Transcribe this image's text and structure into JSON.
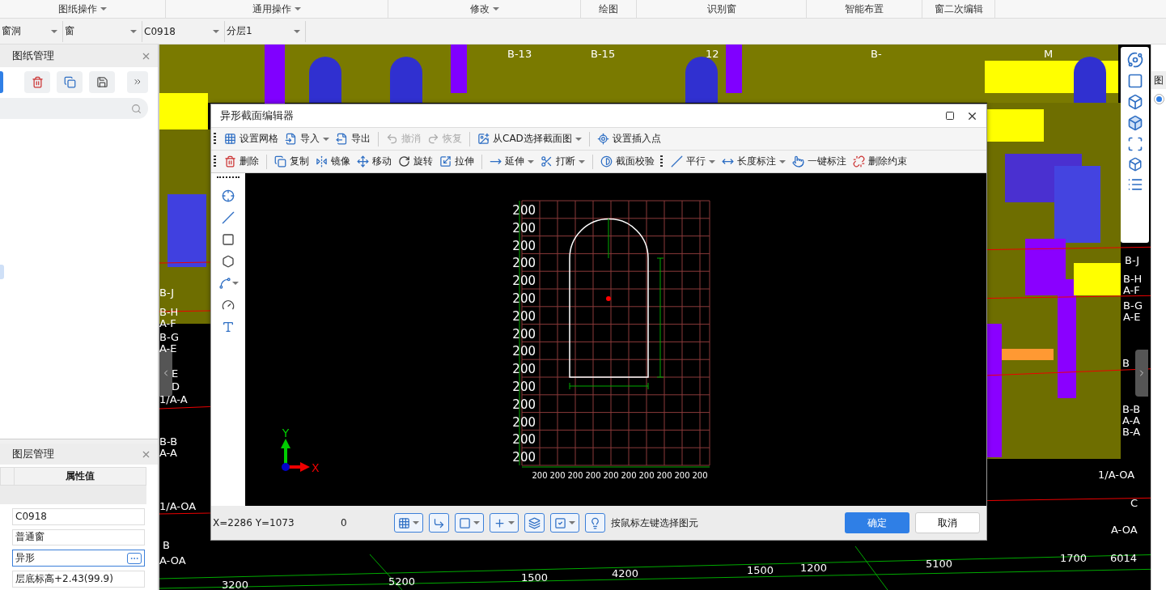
{
  "menu": [
    {
      "label": "图纸操作",
      "dropdown": true
    },
    {
      "label": "通用操作",
      "dropdown": true
    },
    {
      "label": "修改",
      "dropdown": true
    },
    {
      "label": "绘图",
      "dropdown": false
    },
    {
      "label": "识别窗",
      "dropdown": false
    },
    {
      "label": "智能布置",
      "dropdown": false
    },
    {
      "label": "窗二次编辑",
      "dropdown": false
    }
  ],
  "selectors": [
    "窗洞",
    "窗",
    "C0918",
    "分层1"
  ],
  "drawing_panel": {
    "title": "图纸管理"
  },
  "layer_panel": {
    "title": "图层管理",
    "column": "属性值",
    "values": [
      {
        "text": "C0918",
        "focused": false
      },
      {
        "text": "普通窗",
        "focused": false
      },
      {
        "text": "异形",
        "focused": true
      },
      {
        "text": "层底标高+2.43(99.9)",
        "focused": false
      }
    ]
  },
  "viewport": {
    "labels": [
      "B-13",
      "B-15",
      "12",
      "B-",
      "M",
      "B-J",
      "B-H",
      "A-F",
      "B-G",
      "A-E",
      "E",
      "D",
      "1/A-A",
      "B-B",
      "A-A",
      "1/A-OA",
      "B",
      "A-OA",
      "B-J",
      "B-H",
      "A-F",
      "B-G",
      "A-E",
      "B",
      "B-B",
      "A-A",
      "B-A",
      "1/A-OA",
      "C",
      "A-OA",
      "3200",
      "5200",
      "1500",
      "4200",
      "1500",
      "1200",
      "5100",
      "1700",
      "6014"
    ]
  },
  "right_panel": {
    "tab": "图",
    "radio": {
      "selected": true
    }
  },
  "dialog": {
    "title": "异形截面编辑器",
    "toolbar_rows": [
      [
        [
          [
            {
              "kind": "grid",
              "label": "设置网格",
              "dropdown": false,
              "disabled": false
            },
            {
              "kind": "import",
              "label": "导入",
              "dropdown": true,
              "disabled": false
            },
            {
              "kind": "export",
              "label": "导出",
              "dropdown": false,
              "disabled": false
            }
          ],
          [
            {
              "kind": "undo",
              "label": "撤消",
              "dropdown": false,
              "disabled": true
            },
            {
              "kind": "redo",
              "label": "恢复",
              "dropdown": false,
              "disabled": true
            }
          ],
          [
            {
              "kind": "cad",
              "label": "从CAD选择截面图",
              "dropdown": true,
              "disabled": false
            }
          ],
          [
            {
              "kind": "insert",
              "label": "设置插入点",
              "dropdown": false,
              "disabled": false
            }
          ]
        ]
      ],
      [
        [
          [
            {
              "kind": "delete",
              "label": "删除",
              "dropdown": false,
              "disabled": false
            }
          ],
          [
            {
              "kind": "copy",
              "label": "复制",
              "dropdown": false,
              "disabled": false
            },
            {
              "kind": "mirror",
              "label": "镜像",
              "dropdown": false,
              "disabled": false
            },
            {
              "kind": "move",
              "label": "移动",
              "dropdown": false,
              "disabled": false
            },
            {
              "kind": "rotate",
              "label": "旋转",
              "dropdown": false,
              "disabled": false
            },
            {
              "kind": "stretch",
              "label": "拉伸",
              "dropdown": false,
              "disabled": false
            }
          ],
          [
            {
              "kind": "extend",
              "label": "延伸",
              "dropdown": true,
              "disabled": false
            },
            {
              "kind": "break",
              "label": "打断",
              "dropdown": true,
              "disabled": false
            }
          ],
          [
            {
              "kind": "check",
              "label": "截面校验",
              "dropdown": false,
              "disabled": false
            }
          ]
        ],
        [
          [
            {
              "kind": "parallel",
              "label": "平行",
              "dropdown": true,
              "disabled": false
            },
            {
              "kind": "length",
              "label": "长度标注",
              "dropdown": true,
              "disabled": false
            },
            {
              "kind": "autodim",
              "label": "一键标注",
              "dropdown": false,
              "disabled": false
            },
            {
              "kind": "unconstrain",
              "label": "删除约束",
              "dropdown": false,
              "disabled": false
            }
          ]
        ]
      ]
    ],
    "side_tools": [
      {
        "kind": "point",
        "dropdown": false
      },
      {
        "kind": "line",
        "dropdown": false
      },
      {
        "kind": "rect",
        "dropdown": false
      },
      {
        "kind": "polygon",
        "dropdown": false
      },
      {
        "kind": "arc",
        "dropdown": true
      },
      {
        "kind": "circle",
        "dropdown": false
      },
      {
        "kind": "text",
        "dropdown": false
      }
    ],
    "grid": {
      "row_labels": [
        "200",
        "200",
        "200",
        "200",
        "200",
        "200",
        "200",
        "200",
        "200",
        "200",
        "200",
        "200",
        "200",
        "200",
        "200"
      ],
      "col_labels": [
        "200",
        "200",
        "200",
        "200",
        "200",
        "200",
        "200",
        "200",
        "200",
        "200"
      ],
      "axis_x": "X",
      "axis_y": "Y"
    },
    "status": {
      "coords": "X=2286 Y=1073",
      "value": "0",
      "toggles": [
        {
          "kind": "grid",
          "dropdown": true
        },
        {
          "kind": "ortho",
          "dropdown": false
        },
        {
          "kind": "snap",
          "dropdown": true
        },
        {
          "kind": "dim",
          "dropdown": true
        },
        {
          "kind": "track",
          "dropdown": false
        },
        {
          "kind": "select",
          "dropdown": true
        }
      ],
      "hint": "按鼠标左键选择图元",
      "ok": "确定",
      "cancel": "取消"
    }
  }
}
